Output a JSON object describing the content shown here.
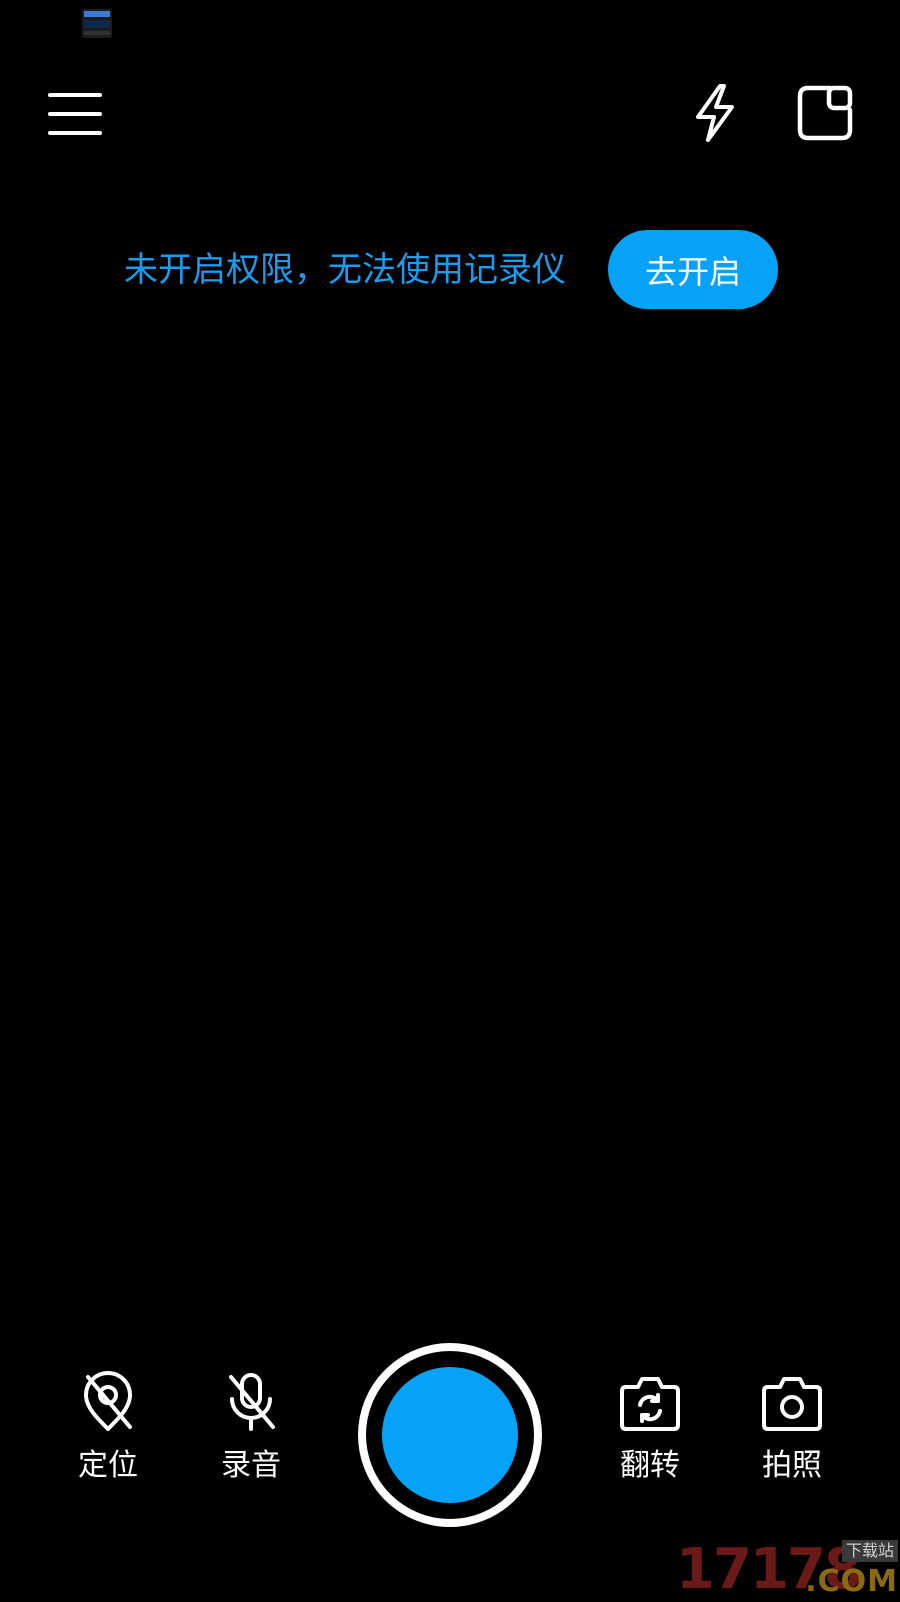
{
  "colors": {
    "background": "#000000",
    "accent": "#06a2f7",
    "permission_text": "#1a9cf0",
    "icon": "#ffffff"
  },
  "top_bar": {
    "menu_icon": "hamburger-menu-icon",
    "flash_icon": "lightning-icon",
    "pip_icon": "picture-in-picture-icon"
  },
  "permission": {
    "message": "未开启权限，无法使用记录仪",
    "button_label": "去开启"
  },
  "controls": {
    "location": {
      "label": "定位",
      "icon": "location-off-icon"
    },
    "audio": {
      "label": "录音",
      "icon": "mic-off-icon"
    },
    "shutter": {
      "icon": "record-button"
    },
    "flip": {
      "label": "翻转",
      "icon": "camera-flip-icon"
    },
    "photo": {
      "label": "拍照",
      "icon": "camera-icon"
    }
  },
  "watermark": {
    "number": "17178",
    "tag": "下载站",
    "suffix": ".COM"
  }
}
